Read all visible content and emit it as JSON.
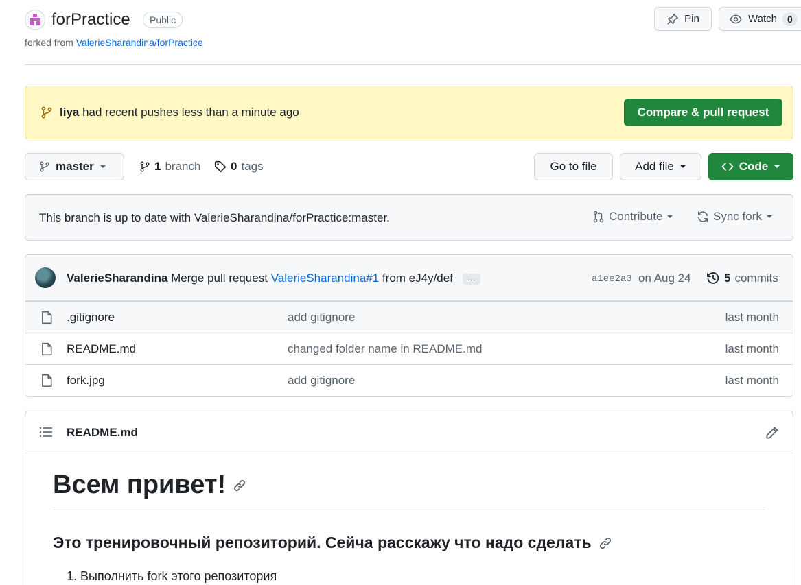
{
  "repo": {
    "name": "forPractice",
    "visibility": "Public",
    "forked_prefix": "forked from",
    "forked_source": "ValerieSharandina/forPractice"
  },
  "actions": {
    "pin_label": "Pin",
    "watch_label": "Watch",
    "watch_count": "0"
  },
  "banner": {
    "user": "liya",
    "message": "had recent pushes less than a minute ago",
    "button_label": "Compare & pull request"
  },
  "toolbar": {
    "branch": "master",
    "branch_count": "1",
    "branch_word": "branch",
    "tag_count": "0",
    "tag_word": "tags",
    "goto_file": "Go to file",
    "add_file": "Add file",
    "code": "Code"
  },
  "fork_status": {
    "text": "This branch is up to date with ValerieSharandina/forPractice:master.",
    "contribute": "Contribute",
    "sync": "Sync fork"
  },
  "latest_commit": {
    "author": "ValerieSharandina",
    "message_prefix": "Merge pull request",
    "pr_link": "ValerieSharandina#1",
    "message_suffix": "from eJ4y/def",
    "ellipsis": "…",
    "sha": "a1ee2a3",
    "date": "on Aug 24",
    "commit_count": "5",
    "commit_word": "commits"
  },
  "files": [
    {
      "name": ".gitignore",
      "message": "add gitignore",
      "age": "last month"
    },
    {
      "name": "README.md",
      "message": "changed folder name in README.md",
      "age": "last month"
    },
    {
      "name": "fork.jpg",
      "message": "add gitignore",
      "age": "last month"
    }
  ],
  "readme": {
    "filename": "README.md",
    "h1": "Всем привет!",
    "h2": "Это тренировочный репозиторий. Сейча расскажу что надо сделать",
    "list_item": "1. Выполнить fork этого репозитория"
  },
  "colors": {
    "primary_green": "#1f883d",
    "banner_yellow": "#fff8c5",
    "link_blue": "#0969da",
    "muted_text": "#59636e"
  }
}
